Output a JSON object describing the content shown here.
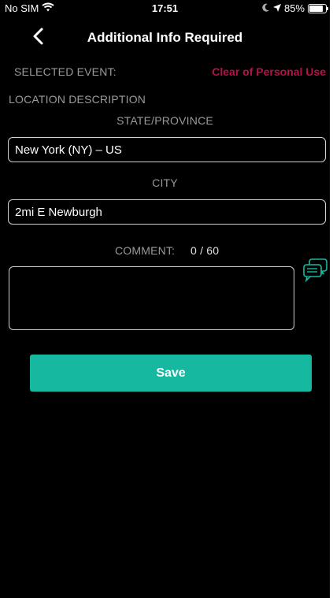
{
  "status_bar": {
    "carrier": "No SIM",
    "time": "17:51",
    "battery": "85%"
  },
  "nav": {
    "title": "Additional Info Required"
  },
  "selected_event": {
    "label": "SELECTED EVENT:",
    "value": "Clear of Personal Use",
    "value_color": "#b4124a"
  },
  "location": {
    "section_label": "LOCATION DESCRIPTION",
    "state_label": "STATE/PROVINCE",
    "state_value": "New York (NY) – US",
    "city_label": "CITY",
    "city_value": "2mi E Newburgh"
  },
  "comment": {
    "label": "COMMENT:",
    "counter": "0 / 60",
    "value": ""
  },
  "actions": {
    "save_label": "Save",
    "save_color": "#17b8a0"
  },
  "icons": [
    "wifi-icon",
    "back-chevron-icon",
    "moon-icon",
    "location-arrow-icon",
    "battery-icon",
    "chat-bubbles-icon"
  ]
}
